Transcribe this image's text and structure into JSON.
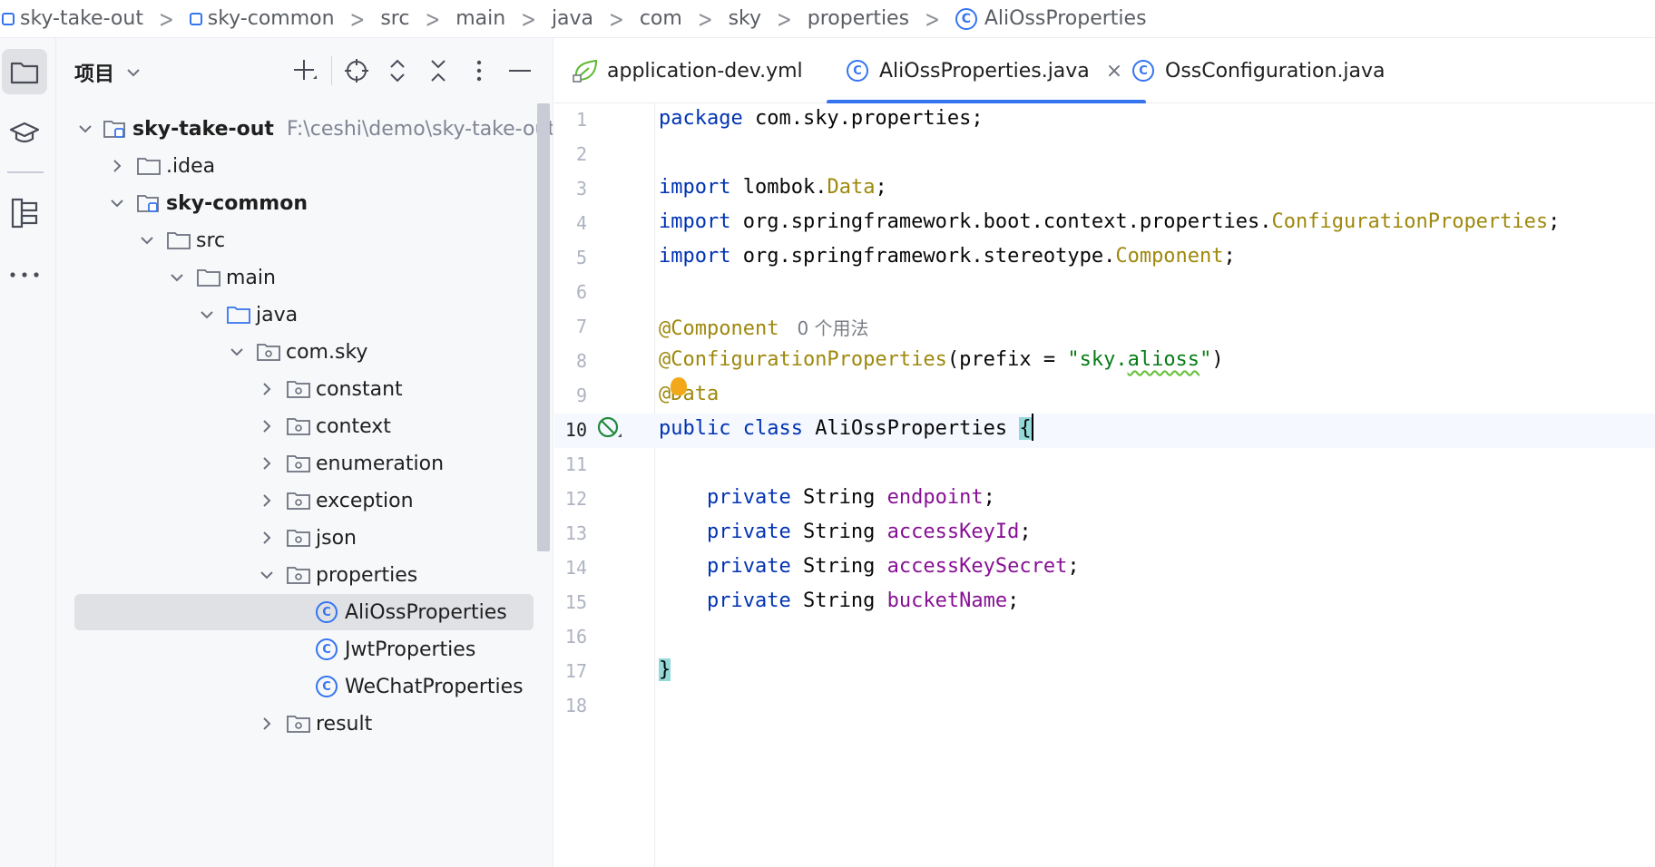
{
  "breadcrumb": {
    "items": [
      "sky-take-out",
      "sky-common",
      "src",
      "main",
      "java",
      "com",
      "sky",
      "properties",
      "AliOssProperties"
    ]
  },
  "project_panel": {
    "title": "项目",
    "tree": [
      {
        "label": "sky-take-out",
        "path": "F:\\ceshi\\demo\\sky-take-out",
        "type": "module",
        "expanded": true
      },
      {
        "label": ".idea",
        "type": "folder",
        "expanded": false
      },
      {
        "label": "sky-common",
        "type": "module",
        "expanded": true
      },
      {
        "label": "src",
        "type": "folder",
        "expanded": true
      },
      {
        "label": "main",
        "type": "folder",
        "expanded": true
      },
      {
        "label": "java",
        "type": "source-folder",
        "expanded": true
      },
      {
        "label": "com.sky",
        "type": "package",
        "expanded": true
      },
      {
        "label": "constant",
        "type": "package",
        "expanded": false
      },
      {
        "label": "context",
        "type": "package",
        "expanded": false
      },
      {
        "label": "enumeration",
        "type": "package",
        "expanded": false
      },
      {
        "label": "exception",
        "type": "package",
        "expanded": false
      },
      {
        "label": "json",
        "type": "package",
        "expanded": false
      },
      {
        "label": "properties",
        "type": "package",
        "expanded": true
      },
      {
        "label": "AliOssProperties",
        "type": "class",
        "selected": true
      },
      {
        "label": "JwtProperties",
        "type": "class"
      },
      {
        "label": "WeChatProperties",
        "type": "class"
      },
      {
        "label": "result",
        "type": "package",
        "expanded": false
      }
    ]
  },
  "tabs": [
    {
      "label": "application-dev.yml",
      "active": false
    },
    {
      "label": "AliOssProperties.java",
      "active": true,
      "close": "×"
    },
    {
      "label": "OssConfiguration.java",
      "active": false
    }
  ],
  "editor": {
    "line_numbers": [
      "1",
      "2",
      "3",
      "4",
      "5",
      "6",
      "7",
      "8",
      "9",
      "10",
      "11",
      "12",
      "13",
      "14",
      "15",
      "16",
      "17",
      "18"
    ],
    "current_line": 10,
    "tokens": {
      "l1_kw": "package",
      "l1_rest": " com.sky.properties;",
      "l3_kw": "import",
      "l3_a": " lombok.",
      "l3_cls": "Data",
      "l3_end": ";",
      "l4_kw": "import",
      "l4_a": " org.springframework.boot.context.properties.",
      "l4_cls": "ConfigurationProperties",
      "l4_end": ";",
      "l5_kw": "import",
      "l5_a": " org.springframework.stereotype.",
      "l5_cls": "Component",
      "l5_end": ";",
      "l7_ann": "@Component",
      "l7_hint": "0 个用法",
      "l8_ann": "@ConfigurationProperties",
      "l8_a": "(prefix = ",
      "l8_str1": "\"sky.",
      "l8_str2": "alioss",
      "l8_str3": "\"",
      "l8_end": ")",
      "l9_ann": "@Data",
      "l10_kw": "public class",
      "l10_name": " AliOssProperties ",
      "l10_brace": "{",
      "l12_kw": "private",
      "l12_type": " String ",
      "l12_fld": "endpoint",
      "l12_end": ";",
      "l13_kw": "private",
      "l13_type": " String ",
      "l13_fld": "accessKeyId",
      "l13_end": ";",
      "l14_kw": "private",
      "l14_type": " String ",
      "l14_fld": "accessKeySecret",
      "l14_end": ";",
      "l15_kw": "private",
      "l15_type": " String ",
      "l15_fld": "bucketName",
      "l15_end": ";",
      "l17_brace": "}"
    }
  },
  "colors": {
    "accent": "#3574f0",
    "keyword": "#0033b3",
    "annotation": "#9e880d",
    "field": "#871094",
    "string": "#067d17",
    "brace_highlight": "#93d9d9"
  },
  "icons": {
    "activity_bar": [
      "folder-icon",
      "learn-icon",
      "structure-icon",
      "more-icon"
    ],
    "project_toolbar": [
      "add-icon",
      "locate-icon",
      "expand-all-icon",
      "collapse-all-icon",
      "options-icon",
      "hide-icon"
    ]
  }
}
